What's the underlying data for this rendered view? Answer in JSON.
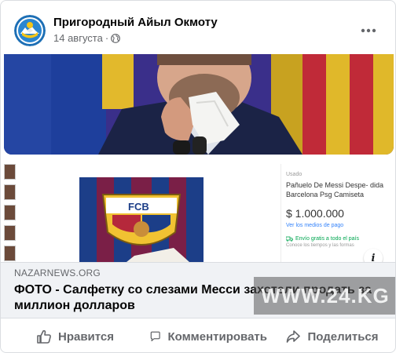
{
  "post": {
    "page_name": "Пригородный Айыл Окмоту",
    "date": "14 августа",
    "separator": "·",
    "privacy_icon": "globe-icon",
    "more_icon": "more-options-icon"
  },
  "media": {
    "listing": {
      "used_label": "Usado",
      "title": "Pañuelo De Messi Despe- dida Barcelona Psg Camiseta",
      "price": "$ 1.000.000",
      "payment_link": "Ver los medios de pago",
      "shipping": "Envío gratis a todo el país",
      "shipping_sub": "Conoce los tiempos y las formas"
    },
    "info_label": "i"
  },
  "link_preview": {
    "domain": "NAZARNEWS.ORG",
    "headline": "ФОТО - Салфетку со слезами Месси захотели продать за миллион долларов",
    "watermark": "WWW.24.KG"
  },
  "actions": {
    "like": "Нравится",
    "comment": "Комментировать",
    "share": "Поделиться"
  },
  "colors": {
    "secondary_text": "#65676b",
    "link_bg": "#f0f2f5",
    "barca_blue": "#004d98",
    "barca_red": "#a50044"
  }
}
